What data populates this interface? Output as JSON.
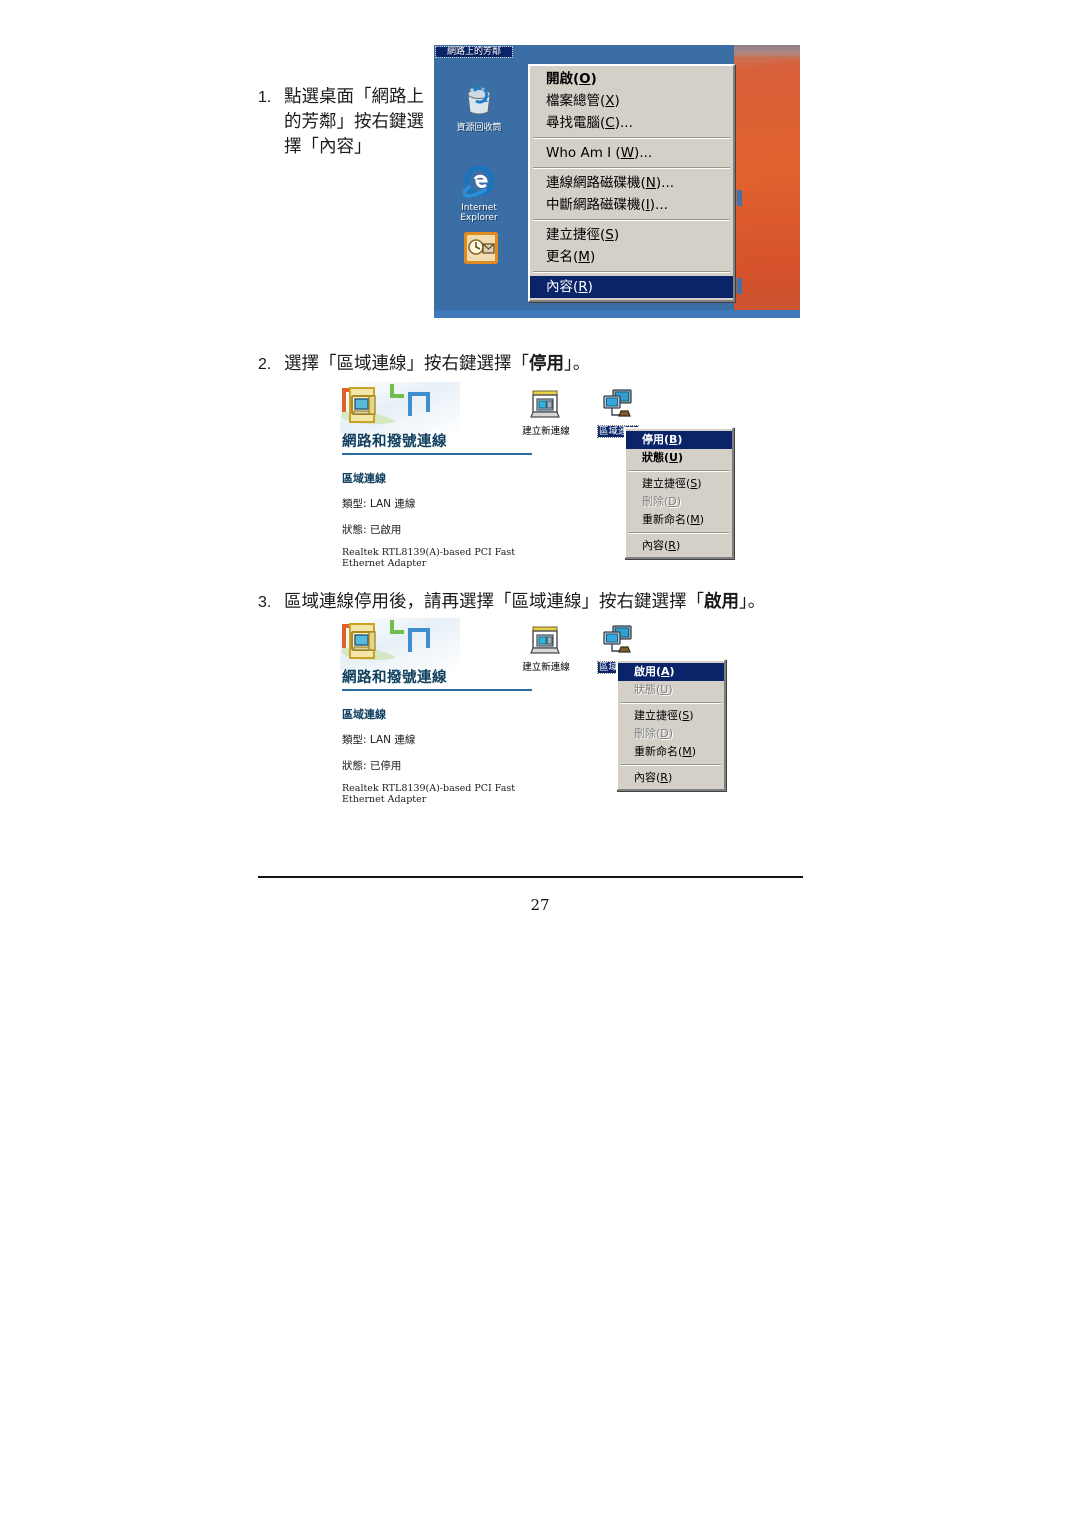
{
  "document": {
    "page_number": "27"
  },
  "steps": [
    {
      "number": "1.",
      "text": "點選桌面「網路上的芳鄰」按右鍵選擇「內容」"
    },
    {
      "number": "2.",
      "prefix": "選擇「區域連線」按右鍵選擇「",
      "emphasis": "停用",
      "suffix": "」。"
    },
    {
      "number": "3.",
      "prefix": "區域連線停用後，請再選擇「區域連線」按右鍵選擇「",
      "emphasis": "啟用",
      "suffix": "」。"
    }
  ],
  "screenshot1": {
    "desktop_icons": [
      {
        "name": "網路上的芳鄰",
        "icon": "network-neighborhood-icon",
        "selected": true
      },
      {
        "name": "資源回收筒",
        "icon": "recycle-bin-icon",
        "selected": false
      },
      {
        "name": "Internet Explorer",
        "icon": "internet-explorer-icon",
        "selected": false
      },
      {
        "name": "",
        "icon": "outlook-express-icon",
        "selected": false
      }
    ],
    "context_menu": {
      "items": [
        {
          "label": "開啟",
          "accel": "O",
          "bold": true,
          "selected": false,
          "disabled": false
        },
        {
          "label": "檔案總管",
          "accel": "X",
          "bold": false,
          "selected": false,
          "disabled": false
        },
        {
          "label": "尋找電腦",
          "accel": "C",
          "ellipsis": "...",
          "bold": false,
          "selected": false,
          "disabled": false
        },
        {
          "separator": true
        },
        {
          "label": "Who Am I ",
          "accel": "W",
          "ellipsis": "...",
          "bold": false,
          "selected": false,
          "disabled": false
        },
        {
          "separator": true
        },
        {
          "label": "連線網路磁碟機",
          "accel": "N",
          "ellipsis": "...",
          "bold": false,
          "selected": false,
          "disabled": false
        },
        {
          "label": "中斷網路磁碟機",
          "accel": "I",
          "ellipsis": "...",
          "bold": false,
          "selected": false,
          "disabled": false
        },
        {
          "separator": true
        },
        {
          "label": "建立捷徑",
          "accel": "S",
          "bold": false,
          "selected": false,
          "disabled": false
        },
        {
          "label": "更名",
          "accel": "M",
          "bold": false,
          "selected": false,
          "disabled": false
        },
        {
          "separator": true
        },
        {
          "label": "內容",
          "accel": "R",
          "bold": false,
          "selected": true,
          "disabled": false
        }
      ]
    },
    "colors": {
      "desktop_blue": "#3b6ea5",
      "wallpaper_orange": "#e2622f",
      "menu_highlight": "#0a246a"
    }
  },
  "screenshot2": {
    "window_title": "網路和撥號連線",
    "details": {
      "connection_name": "區域連線",
      "type_label": "類型: LAN 連線",
      "status_label": "狀態: 已啟用",
      "adapter_line1": "Realtek RTL8139(A)-based PCI Fast",
      "adapter_line2": "Ethernet Adapter"
    },
    "icons": [
      {
        "name": "建立新連線",
        "icon": "make-new-connection-icon",
        "selected": false
      },
      {
        "name": "區域連線",
        "icon": "local-area-connection-icon",
        "selected": true
      }
    ],
    "context_menu": {
      "items": [
        {
          "label": "停用",
          "accel": "B",
          "bold": true,
          "selected": true,
          "disabled": false
        },
        {
          "label": "狀態",
          "accel": "U",
          "bold": true,
          "selected": false,
          "disabled": false
        },
        {
          "separator": true
        },
        {
          "label": "建立捷徑",
          "accel": "S",
          "bold": false,
          "selected": false,
          "disabled": false
        },
        {
          "label": "刪除",
          "accel": "D",
          "bold": false,
          "selected": false,
          "disabled": true
        },
        {
          "label": "重新命名",
          "accel": "M",
          "bold": false,
          "selected": false,
          "disabled": false
        },
        {
          "separator": true
        },
        {
          "label": "內容",
          "accel": "R",
          "bold": false,
          "selected": false,
          "disabled": false
        }
      ]
    }
  },
  "screenshot3": {
    "window_title": "網路和撥號連線",
    "details": {
      "connection_name": "區域連線",
      "type_label": "類型: LAN 連線",
      "status_label": "狀態: 已停用",
      "adapter_line1": "Realtek RTL8139(A)-based PCI Fast",
      "adapter_line2": "Ethernet Adapter"
    },
    "icons": [
      {
        "name": "建立新連線",
        "icon": "make-new-connection-icon",
        "selected": false
      },
      {
        "name": "區域連線",
        "icon": "local-area-connection-icon",
        "selected": true
      }
    ],
    "context_menu": {
      "items": [
        {
          "label": "啟用",
          "accel": "A",
          "bold": true,
          "selected": true,
          "disabled": false
        },
        {
          "label": "狀態",
          "accel": "U",
          "bold": false,
          "selected": false,
          "disabled": true
        },
        {
          "separator": true
        },
        {
          "label": "建立捷徑",
          "accel": "S",
          "bold": false,
          "selected": false,
          "disabled": false
        },
        {
          "label": "刪除",
          "accel": "D",
          "bold": false,
          "selected": false,
          "disabled": true
        },
        {
          "label": "重新命名",
          "accel": "M",
          "bold": false,
          "selected": false,
          "disabled": false
        },
        {
          "separator": true
        },
        {
          "label": "內容",
          "accel": "R",
          "bold": false,
          "selected": false,
          "disabled": false
        }
      ]
    }
  }
}
